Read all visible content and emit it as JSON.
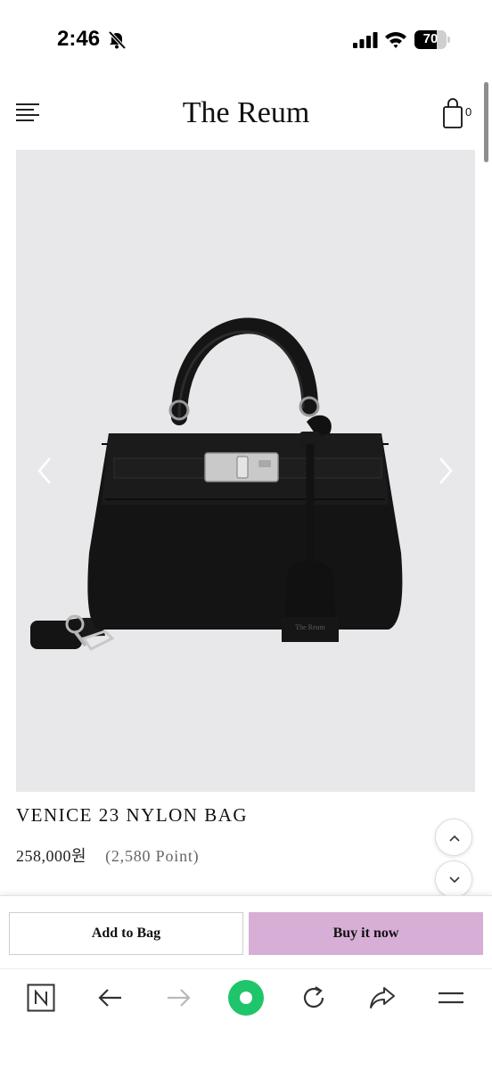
{
  "status_bar": {
    "time": "2:46",
    "battery_percent": "70",
    "battery_level": 0.7,
    "icons": [
      "bell-slash-icon",
      "signal-icon",
      "wifi-icon",
      "battery-icon"
    ]
  },
  "header": {
    "brand": "The Reum",
    "cart_count": "0",
    "icons": [
      "menu-icon",
      "shopping-bag-icon"
    ]
  },
  "gallery": {
    "icons": [
      "chevron-left-icon",
      "chevron-right-icon"
    ],
    "tag_text": "The Reum"
  },
  "product": {
    "name": "VENICE 23 NYLON BAG",
    "price": "258,000원",
    "points": "(2,580 Point)"
  },
  "actions": {
    "add_to_bag": "Add to Bag",
    "buy_now": "Buy it now",
    "buy_color": "#d7aed6"
  },
  "browser_toolbar": {
    "icons": [
      "n-home-icon",
      "back-arrow-icon",
      "forward-arrow-icon",
      "green-dot-icon",
      "refresh-icon",
      "share-icon",
      "hamburger-menu-icon"
    ],
    "accent": "#1ec56a"
  }
}
